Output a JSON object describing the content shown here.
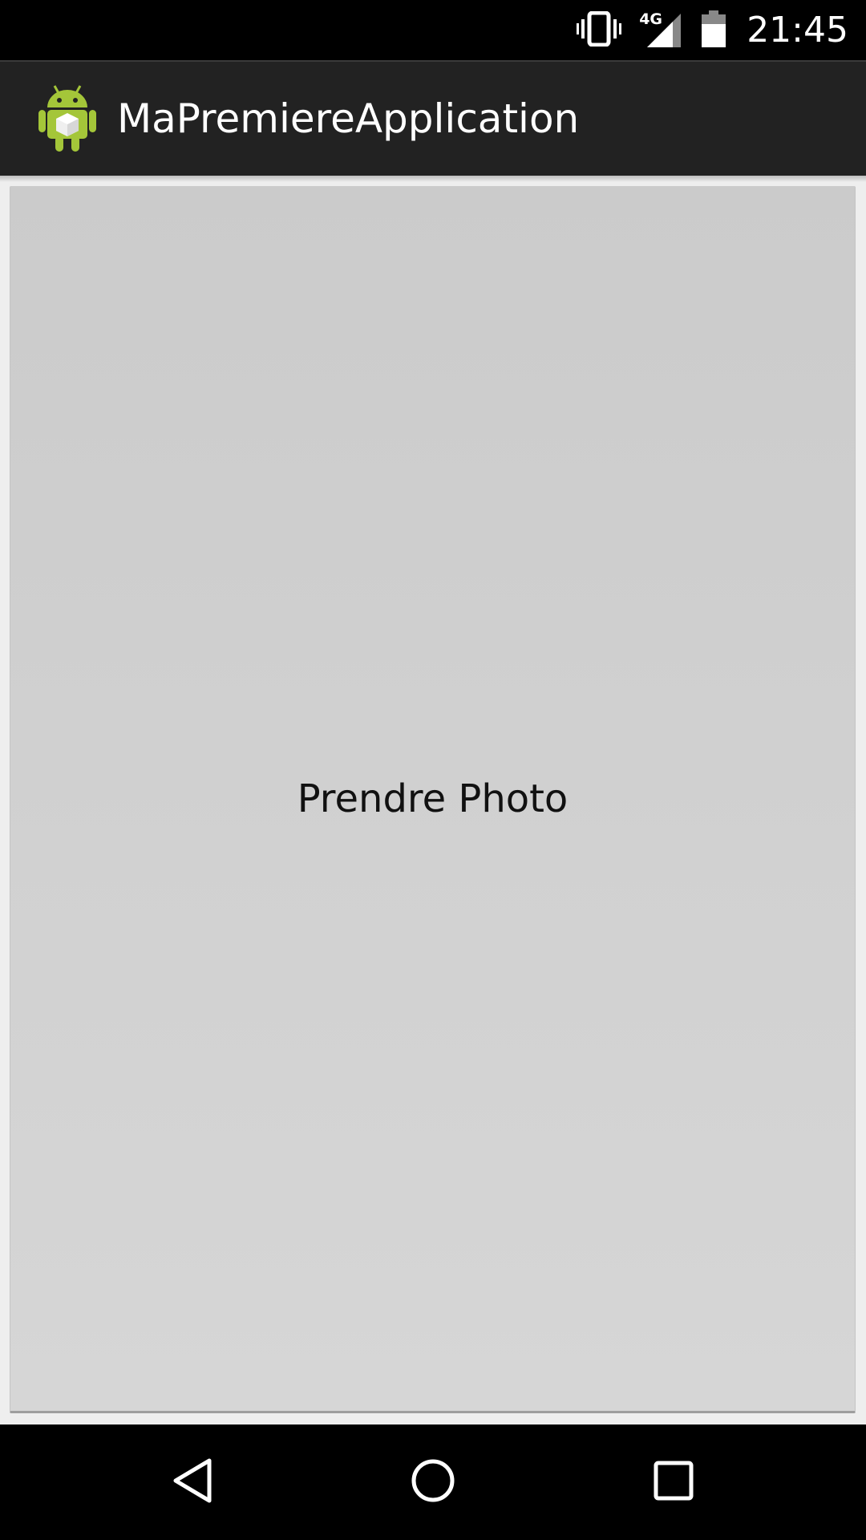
{
  "status_bar": {
    "time": "21:45",
    "network_label": "4G",
    "icons": [
      "vibrate-icon",
      "signal-4g-icon",
      "battery-icon"
    ]
  },
  "action_bar": {
    "app_icon": "android-robot-icon",
    "title": "MaPremiereApplication"
  },
  "main": {
    "button_label": "Prendre Photo"
  },
  "nav_bar": {
    "buttons": [
      "back-icon",
      "home-icon",
      "recents-icon"
    ]
  },
  "colors": {
    "status_bar": "#000000",
    "action_bar": "#222222",
    "content_bg": "#eeeeee",
    "button_bg": "#d0d0d0",
    "nav_bar": "#000000",
    "android_green": "#a4c639"
  }
}
